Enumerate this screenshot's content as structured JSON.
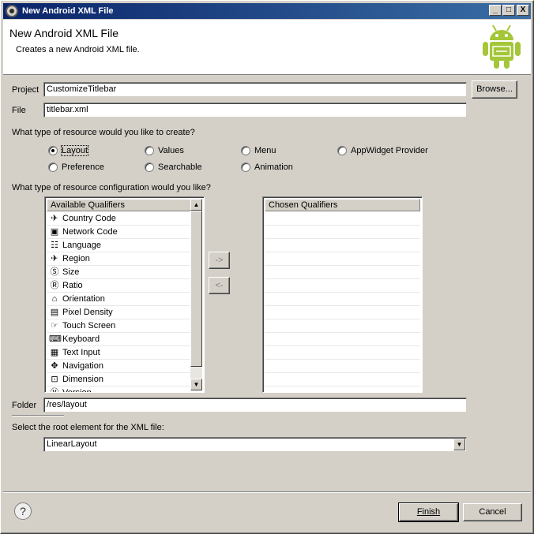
{
  "window": {
    "title": "New Android XML File",
    "minimize": "_",
    "maximize": "□",
    "close": "X"
  },
  "header": {
    "title": "New Android XML File",
    "description": "Creates a new Android XML file."
  },
  "project": {
    "label": "Project",
    "value": "CustomizeTitlebar",
    "browse_label": "Browse..."
  },
  "file": {
    "label": "File",
    "value": "titlebar.xml"
  },
  "resource_type": {
    "question": "What type of resource would you like to create?",
    "options": [
      {
        "label": "Layout",
        "selected": true
      },
      {
        "label": "Values",
        "selected": false
      },
      {
        "label": "Menu",
        "selected": false
      },
      {
        "label": "AppWidget Provider",
        "selected": false
      },
      {
        "label": "Preference",
        "selected": false
      },
      {
        "label": "Searchable",
        "selected": false
      },
      {
        "label": "Animation",
        "selected": false
      }
    ]
  },
  "configuration": {
    "question": "What type of resource configuration would you like?",
    "available_header": "Available Qualifiers",
    "chosen_header": "Chosen Qualifiers",
    "add_label": "->",
    "remove_label": "<-",
    "qualifiers": [
      {
        "label": "Country Code",
        "icon": "country-code-icon",
        "glyph": "✈"
      },
      {
        "label": "Network Code",
        "icon": "network-code-icon",
        "glyph": "▣"
      },
      {
        "label": "Language",
        "icon": "language-icon",
        "glyph": "☷"
      },
      {
        "label": "Region",
        "icon": "region-icon",
        "glyph": "✈"
      },
      {
        "label": "Size",
        "icon": "size-icon",
        "glyph": "Ⓢ"
      },
      {
        "label": "Ratio",
        "icon": "ratio-icon",
        "glyph": "Ⓡ"
      },
      {
        "label": "Orientation",
        "icon": "orientation-icon",
        "glyph": "⌂"
      },
      {
        "label": "Pixel Density",
        "icon": "pixel-density-icon",
        "glyph": "▤"
      },
      {
        "label": "Touch Screen",
        "icon": "touch-screen-icon",
        "glyph": "☞"
      },
      {
        "label": "Keyboard",
        "icon": "keyboard-icon",
        "glyph": "⌨"
      },
      {
        "label": "Text Input",
        "icon": "text-input-icon",
        "glyph": "▦"
      },
      {
        "label": "Navigation",
        "icon": "navigation-icon",
        "glyph": "✥"
      },
      {
        "label": "Dimension",
        "icon": "dimension-icon",
        "glyph": "⊡"
      },
      {
        "label": "Version",
        "icon": "version-icon",
        "glyph": "Ⓥ"
      }
    ]
  },
  "folder": {
    "label": "Folder",
    "value": "/res/layout"
  },
  "root_element": {
    "question": "Select the root element for the XML file:",
    "value": "LinearLayout"
  },
  "footer": {
    "help": "?",
    "finish_label": "Finish",
    "cancel_label": "Cancel"
  },
  "colors": {
    "android_green": "#a4c639",
    "title_bar_start": "#0a246a",
    "title_bar_end": "#3a6ea5"
  }
}
